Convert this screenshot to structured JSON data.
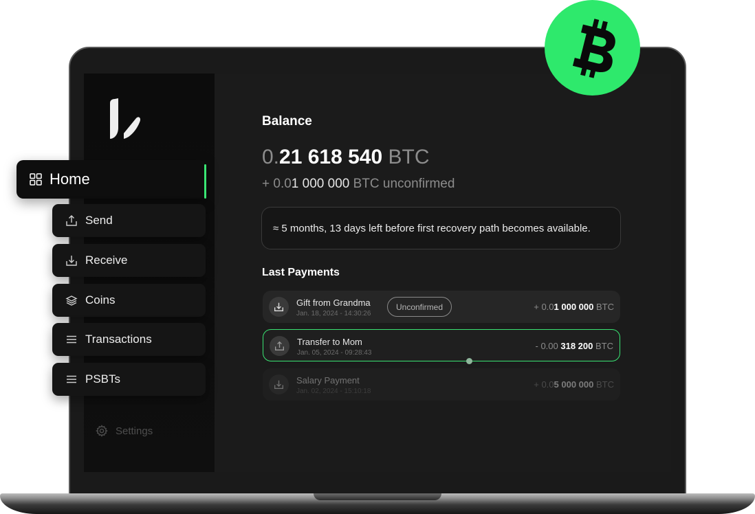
{
  "sidebar": {
    "items": [
      {
        "label": "Home",
        "icon": "grid-icon",
        "active": true
      },
      {
        "label": "Send",
        "icon": "upload-icon"
      },
      {
        "label": "Receive",
        "icon": "download-icon"
      },
      {
        "label": "Coins",
        "icon": "layers-icon"
      },
      {
        "label": "Transactions",
        "icon": "list-icon"
      },
      {
        "label": "PSBTs",
        "icon": "list-icon"
      }
    ],
    "settings_label": "Settings"
  },
  "balance": {
    "title": "Balance",
    "amount_prefix": "0.",
    "amount_main": "21 618 540",
    "unit": "BTC",
    "unconfirmed_prefix": "+ 0.0",
    "unconfirmed_main": "1 000 000",
    "unconfirmed_suffix": "BTC unconfirmed"
  },
  "recovery_notice": "≈ 5 months, 13 days left before first recovery path becomes available.",
  "payments": {
    "title": "Last Payments",
    "rows": [
      {
        "name": "Gift from Grandma",
        "date": "Jan. 18, 2024 - 14:30:26",
        "badge": "Unconfirmed",
        "amount_prefix": "+ 0.0",
        "amount_main": "1 000 000",
        "unit": "BTC",
        "direction": "incoming"
      },
      {
        "name": "Transfer to Mom",
        "date": "Jan. 05, 2024 - 09:28:43",
        "badge": "",
        "amount_prefix": "- 0.00",
        "amount_main": "318 200",
        "unit": "BTC",
        "direction": "outgoing"
      },
      {
        "name": "Salary Payment",
        "date": "Jan. 02, 2024 - 15:10:18",
        "badge": "",
        "amount_prefix": "+ 0.0",
        "amount_main": "5 000 000",
        "unit": "BTC",
        "direction": "incoming"
      }
    ]
  },
  "brand": {
    "badge_glyph": "B",
    "accent": "#3ae573",
    "badge_color": "#2ee96c"
  }
}
